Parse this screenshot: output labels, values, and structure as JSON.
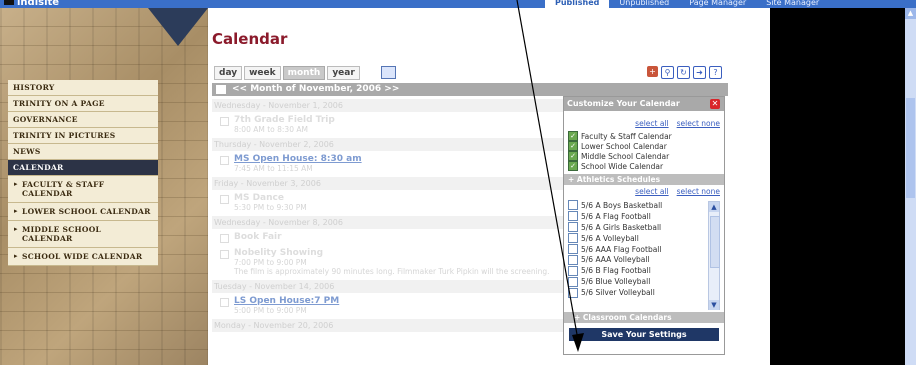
{
  "app": {
    "logo": "indlsite",
    "top_tabs": [
      "Published",
      "Unpublished",
      "Page Manager",
      "Site Manager"
    ],
    "active_tab": 0
  },
  "nav": {
    "items": [
      "HISTORY",
      "TRINITY ON A PAGE",
      "GOVERNANCE",
      "TRINITY IN PICTURES",
      "NEWS",
      "CALENDAR"
    ],
    "active": "CALENDAR",
    "subitems": [
      "FACULTY & STAFF CALENDAR",
      "LOWER SCHOOL CALENDAR",
      "MIDDLE SCHOOL CALENDAR",
      "SCHOOL WIDE CALENDAR"
    ]
  },
  "page": {
    "title": "Calendar",
    "views": [
      "day",
      "week",
      "month",
      "year"
    ],
    "active_view": "month",
    "month_nav": "<< Month of November, 2006 >>"
  },
  "events": [
    {
      "day": "Wednesday - November 1, 2006",
      "items": [
        {
          "title": "7th Grade Field Trip",
          "time": "8:00 AM to 8:30 AM",
          "link": false
        }
      ]
    },
    {
      "day": "Thursday - November 2, 2006",
      "items": [
        {
          "title": "MS Open House: 8:30 am",
          "time": "7:45 AM to 11:15 AM",
          "link": true
        }
      ]
    },
    {
      "day": "Friday - November 3, 2006",
      "items": [
        {
          "title": "MS Dance",
          "time": "5:30 PM to 9:30 PM",
          "link": false
        }
      ]
    },
    {
      "day": "Wednesday - November 8, 2006",
      "items": [
        {
          "title": "Book Fair",
          "time": "",
          "link": false
        },
        {
          "title": "Nobelity Showing",
          "time": "7:00 PM to 9:00 PM",
          "desc": "The film is approximately 90 minutes long.  Filmmaker Turk Pipkin will the screening.",
          "link": false
        }
      ]
    },
    {
      "day": "Tuesday - November 14, 2006",
      "items": [
        {
          "title": "LS Open House:7 PM",
          "time": "5:00 PM to 9:00 PM",
          "link": true
        }
      ]
    },
    {
      "day": "Monday - November 20, 2006",
      "items": []
    }
  ],
  "customize": {
    "title": "Customize Your Calendar",
    "select_all": "select all",
    "select_none": "select none",
    "calendars": [
      {
        "label": "Faculty & Staff Calendar",
        "checked": true
      },
      {
        "label": "Lower School Calendar",
        "checked": true
      },
      {
        "label": "Middle School Calendar",
        "checked": true
      },
      {
        "label": "School Wide Calendar",
        "checked": true
      }
    ],
    "athletics_header": "+ Athletics Schedules",
    "athletics": [
      "5/6 A Boys Basketball",
      "5/6 A Flag Football",
      "5/6 A Girls Basketball",
      "5/6 A Volleyball",
      "5/6 AAA Flag Football",
      "5/6 AAA Volleyball",
      "5/6 B Flag Football",
      "5/6 Blue Volleyball",
      "5/6 Silver Volleyball"
    ],
    "classroom_header": "+ Classroom Calendars",
    "save_label": "Save Your Settings"
  },
  "colors": {
    "title": "#8b1a2b",
    "nav_active": "#2c3346",
    "save_button": "#1f3766",
    "top_bar": "#3a6fc8"
  }
}
